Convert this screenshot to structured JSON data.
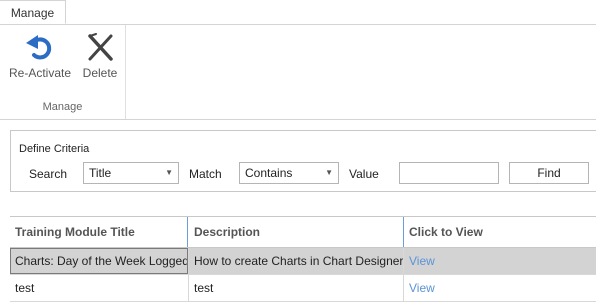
{
  "ribbon": {
    "tab_label": "Manage",
    "buttons": [
      {
        "label": "Re-Activate",
        "icon": "reactivate-arrow-icon"
      },
      {
        "label": "Delete",
        "icon": "delete-x-icon"
      }
    ],
    "group_label": "Manage",
    "colors": {
      "reactivate_icon": "#2b6cc4",
      "delete_icon": "#444444"
    }
  },
  "criteria": {
    "title": "Define Criteria",
    "search_label": "Search",
    "search_value": "Title",
    "match_label": "Match",
    "match_value": "Contains",
    "value_label": "Value",
    "value_input": "",
    "find_label": "Find"
  },
  "grid": {
    "columns": [
      "Training Module Title",
      "Description",
      "Click to View"
    ],
    "rows": [
      {
        "title": "Charts: Day of the Week Logged",
        "description": "How to create Charts in Chart Designer",
        "view": "View",
        "selected": true
      },
      {
        "title": "test",
        "description": "test",
        "view": "View",
        "selected": false
      }
    ],
    "colors": {
      "link": "#5a93d6",
      "selected_row": "#d3d3d3",
      "header_separator": "#6a9ed6"
    }
  }
}
